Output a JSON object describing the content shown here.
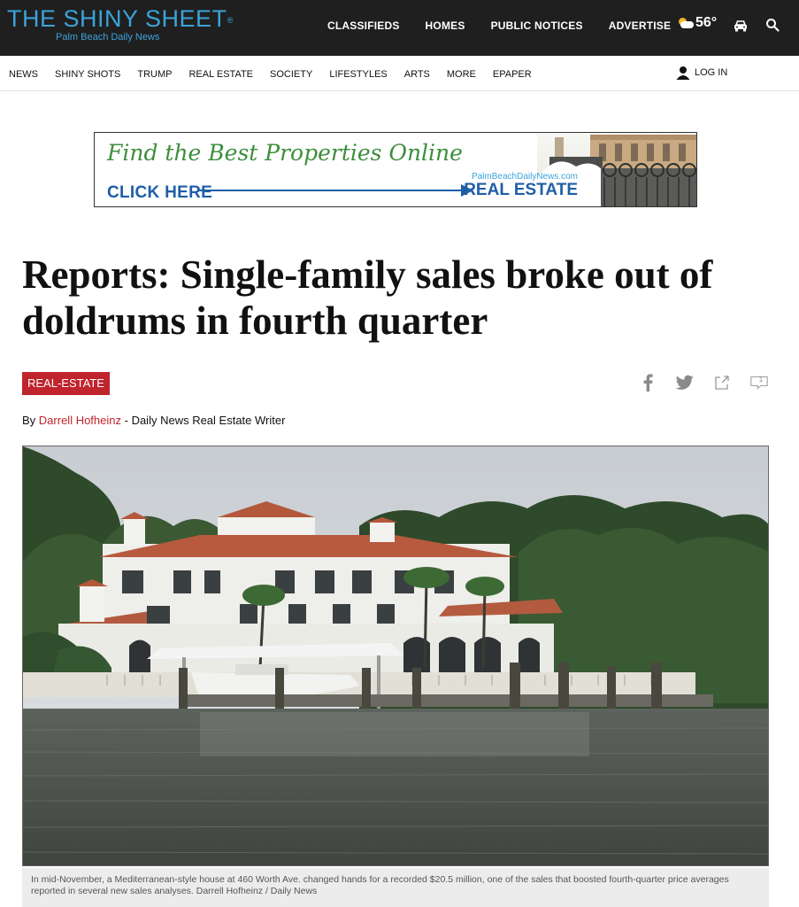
{
  "header": {
    "logo_title": "THE SHINY SHEET",
    "logo_reg": "®",
    "logo_subtitle": "Palm Beach Daily News",
    "top_nav": [
      "CLASSIFIEDS",
      "HOMES",
      "PUBLIC NOTICES",
      "ADVERTISE"
    ],
    "temperature": "56°",
    "weather_icon": "partly-cloudy-icon",
    "car_icon": "car-icon",
    "search_icon": "search-icon",
    "bg_color": "#1f1f1f",
    "logo_color": "#3ba3d9"
  },
  "section_nav": {
    "items": [
      "NEWS",
      "SHINY SHOTS",
      "TRUMP",
      "REAL ESTATE",
      "SOCIETY",
      "LIFESTYLES",
      "ARTS",
      "MORE",
      "EPAPER"
    ],
    "login_label": "LOG IN",
    "login_icon": "user-icon"
  },
  "ad": {
    "headline": "Find the Best Properties Online",
    "cta": "CLICK HERE",
    "site": "PalmBeachDailyNews.com",
    "section": "REAL ESTATE"
  },
  "article": {
    "headline": "Reports: Single-family sales broke out of doldrums in fourth quarter",
    "tag": "REAL-ESTATE",
    "tag_color": "#c0242c",
    "byline_prefix": "By",
    "author": "Darrell Hofheinz",
    "byline_suffix": "- Daily News Real Estate Writer",
    "comment_count": "1",
    "share_icons": [
      "facebook-icon",
      "twitter-icon",
      "share-icon",
      "comment-icon"
    ],
    "photo_caption": "In mid-November, a Mediterranean-style house at 460 Worth Ave. changed hands for a recorded $20.5 million, one of the sales that boosted fourth-quarter price averages reported in several new sales analyses. Darrell Hofheinz / Daily News"
  }
}
